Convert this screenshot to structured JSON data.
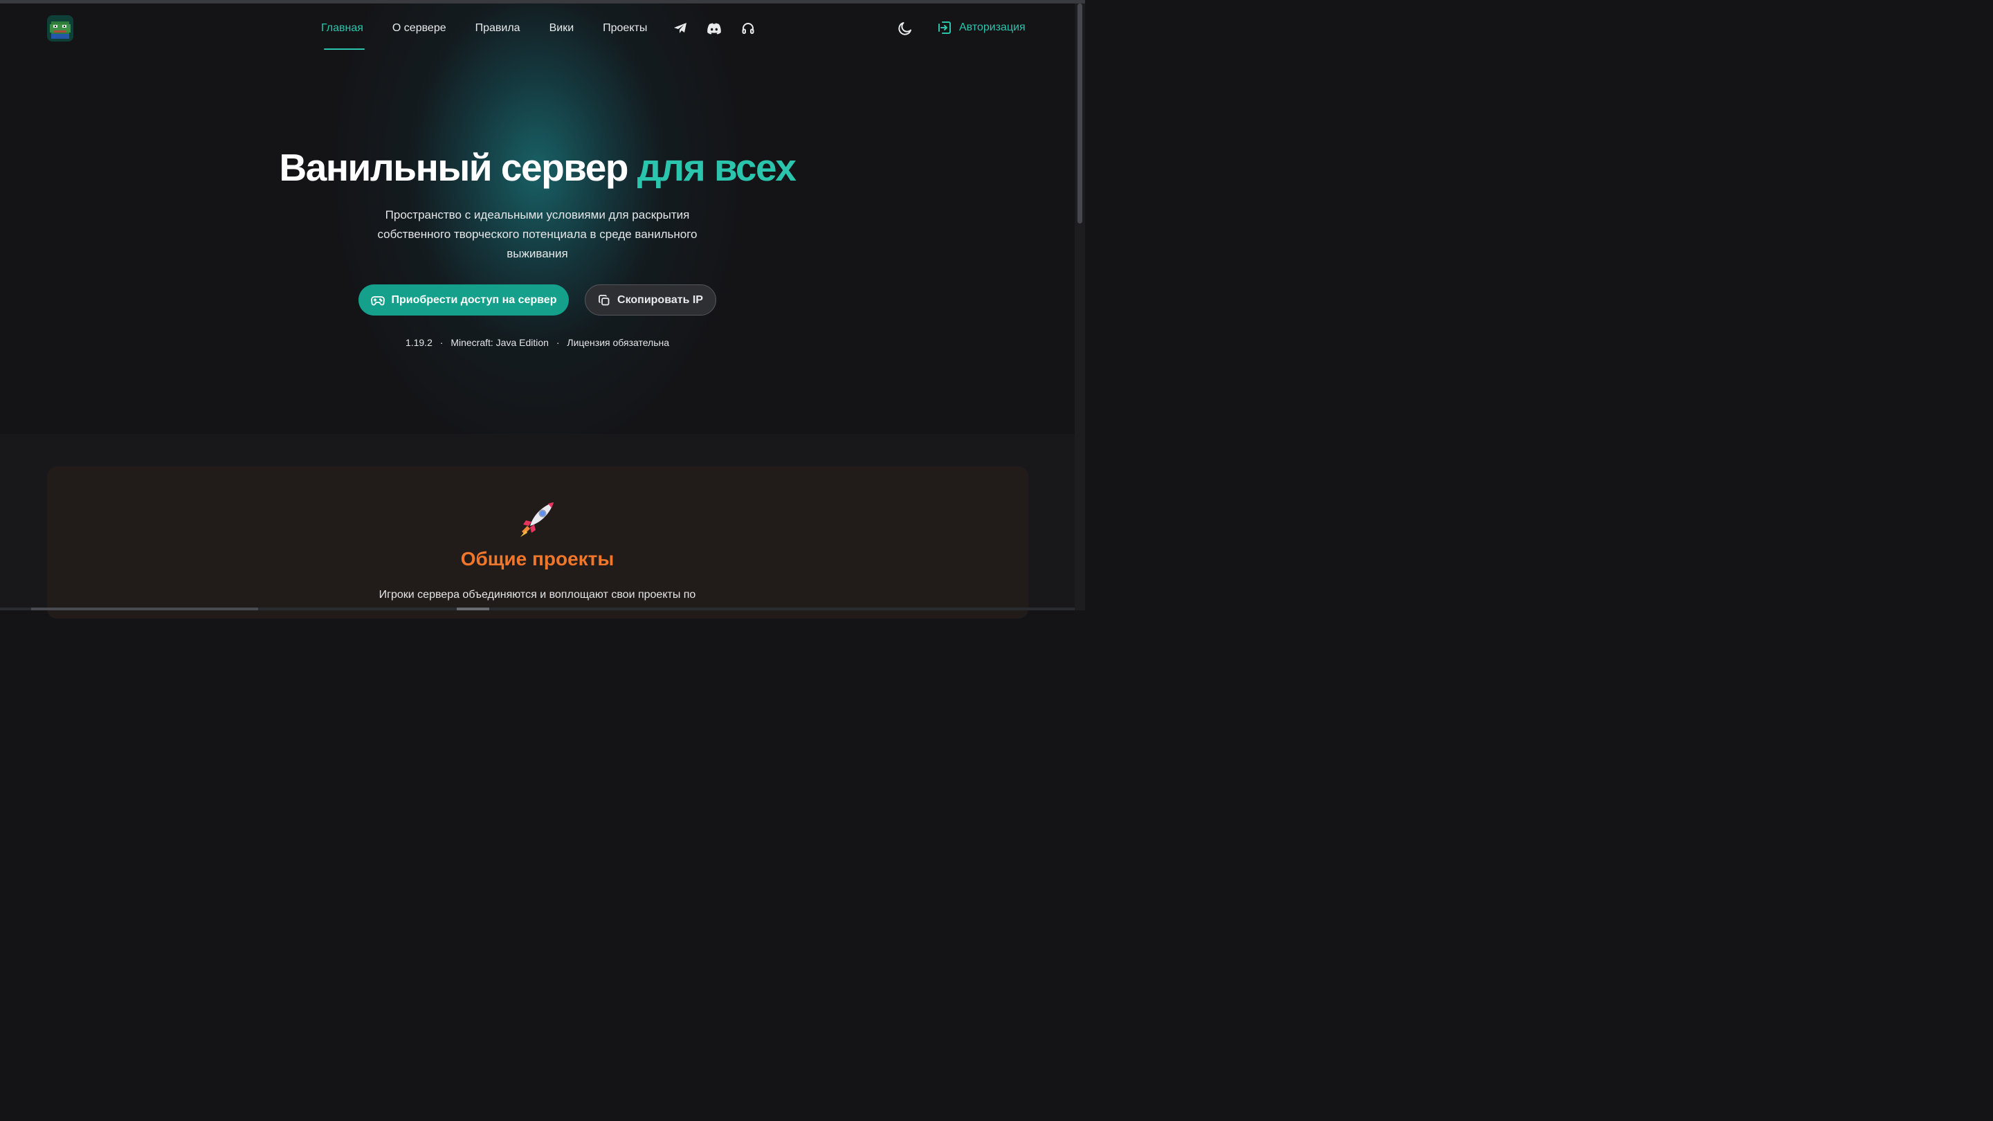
{
  "nav": {
    "logo_alt": "logo",
    "items": [
      {
        "label": "Главная",
        "active": true
      },
      {
        "label": "О сервере"
      },
      {
        "label": "Правила"
      },
      {
        "label": "Вики"
      },
      {
        "label": "Проекты"
      }
    ],
    "icons": [
      "telegram-icon",
      "discord-icon",
      "headset-icon"
    ],
    "theme_icon": "moon-icon",
    "auth_label": "Авторизация"
  },
  "hero": {
    "title_main": "Ванильный сервер",
    "title_accent": "для всех",
    "subtitle": "Пространство с идеальными условиями для раскрытия собственного творческого потенциала в среде ванильного выживания",
    "primary_button": "Приобрести доступ на сервер",
    "secondary_button": "Скопировать IP",
    "meta": {
      "version": "1.19.2",
      "edition": "Minecraft: Java Edition",
      "license": "Лицензия обязательна",
      "separator": "·"
    }
  },
  "projects": {
    "title": "Общие проекты",
    "text": "Игроки сервера объединяются и воплощают свои проекты по"
  },
  "colors": {
    "accent": "#2bc4ad",
    "button_primary": "#15a08c",
    "projects_title": "#f0762a",
    "background": "#141417"
  }
}
